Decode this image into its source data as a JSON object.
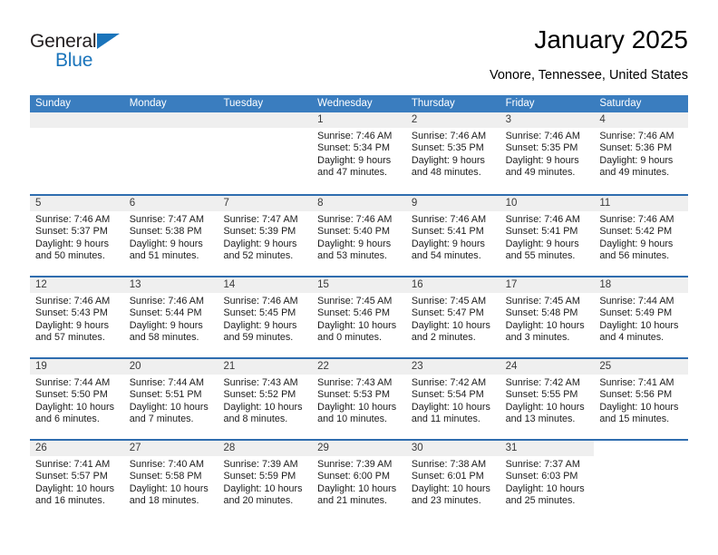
{
  "brand": {
    "name_part1": "General",
    "name_part2": "Blue",
    "accent_color": "#1a74bb"
  },
  "header": {
    "title": "January 2025",
    "location": "Vonore, Tennessee, United States"
  },
  "theme": {
    "header_blue": "#3a7dbf",
    "divider_blue": "#2f6daf",
    "daynum_band": "#efefef"
  },
  "weekdays": [
    "Sunday",
    "Monday",
    "Tuesday",
    "Wednesday",
    "Thursday",
    "Friday",
    "Saturday"
  ],
  "labels": {
    "sunrise": "Sunrise:",
    "sunset": "Sunset:",
    "daylight": "Daylight:"
  },
  "weeks": [
    [
      {
        "empty": true
      },
      {
        "empty": true
      },
      {
        "empty": true
      },
      {
        "day": "1",
        "sunrise": "Sunrise: 7:46 AM",
        "sunset": "Sunset: 5:34 PM",
        "daylight1": "Daylight: 9 hours",
        "daylight2": "and 47 minutes."
      },
      {
        "day": "2",
        "sunrise": "Sunrise: 7:46 AM",
        "sunset": "Sunset: 5:35 PM",
        "daylight1": "Daylight: 9 hours",
        "daylight2": "and 48 minutes."
      },
      {
        "day": "3",
        "sunrise": "Sunrise: 7:46 AM",
        "sunset": "Sunset: 5:35 PM",
        "daylight1": "Daylight: 9 hours",
        "daylight2": "and 49 minutes."
      },
      {
        "day": "4",
        "sunrise": "Sunrise: 7:46 AM",
        "sunset": "Sunset: 5:36 PM",
        "daylight1": "Daylight: 9 hours",
        "daylight2": "and 49 minutes."
      }
    ],
    [
      {
        "day": "5",
        "sunrise": "Sunrise: 7:46 AM",
        "sunset": "Sunset: 5:37 PM",
        "daylight1": "Daylight: 9 hours",
        "daylight2": "and 50 minutes."
      },
      {
        "day": "6",
        "sunrise": "Sunrise: 7:47 AM",
        "sunset": "Sunset: 5:38 PM",
        "daylight1": "Daylight: 9 hours",
        "daylight2": "and 51 minutes."
      },
      {
        "day": "7",
        "sunrise": "Sunrise: 7:47 AM",
        "sunset": "Sunset: 5:39 PM",
        "daylight1": "Daylight: 9 hours",
        "daylight2": "and 52 minutes."
      },
      {
        "day": "8",
        "sunrise": "Sunrise: 7:46 AM",
        "sunset": "Sunset: 5:40 PM",
        "daylight1": "Daylight: 9 hours",
        "daylight2": "and 53 minutes."
      },
      {
        "day": "9",
        "sunrise": "Sunrise: 7:46 AM",
        "sunset": "Sunset: 5:41 PM",
        "daylight1": "Daylight: 9 hours",
        "daylight2": "and 54 minutes."
      },
      {
        "day": "10",
        "sunrise": "Sunrise: 7:46 AM",
        "sunset": "Sunset: 5:41 PM",
        "daylight1": "Daylight: 9 hours",
        "daylight2": "and 55 minutes."
      },
      {
        "day": "11",
        "sunrise": "Sunrise: 7:46 AM",
        "sunset": "Sunset: 5:42 PM",
        "daylight1": "Daylight: 9 hours",
        "daylight2": "and 56 minutes."
      }
    ],
    [
      {
        "day": "12",
        "sunrise": "Sunrise: 7:46 AM",
        "sunset": "Sunset: 5:43 PM",
        "daylight1": "Daylight: 9 hours",
        "daylight2": "and 57 minutes."
      },
      {
        "day": "13",
        "sunrise": "Sunrise: 7:46 AM",
        "sunset": "Sunset: 5:44 PM",
        "daylight1": "Daylight: 9 hours",
        "daylight2": "and 58 minutes."
      },
      {
        "day": "14",
        "sunrise": "Sunrise: 7:46 AM",
        "sunset": "Sunset: 5:45 PM",
        "daylight1": "Daylight: 9 hours",
        "daylight2": "and 59 minutes."
      },
      {
        "day": "15",
        "sunrise": "Sunrise: 7:45 AM",
        "sunset": "Sunset: 5:46 PM",
        "daylight1": "Daylight: 10 hours",
        "daylight2": "and 0 minutes."
      },
      {
        "day": "16",
        "sunrise": "Sunrise: 7:45 AM",
        "sunset": "Sunset: 5:47 PM",
        "daylight1": "Daylight: 10 hours",
        "daylight2": "and 2 minutes."
      },
      {
        "day": "17",
        "sunrise": "Sunrise: 7:45 AM",
        "sunset": "Sunset: 5:48 PM",
        "daylight1": "Daylight: 10 hours",
        "daylight2": "and 3 minutes."
      },
      {
        "day": "18",
        "sunrise": "Sunrise: 7:44 AM",
        "sunset": "Sunset: 5:49 PM",
        "daylight1": "Daylight: 10 hours",
        "daylight2": "and 4 minutes."
      }
    ],
    [
      {
        "day": "19",
        "sunrise": "Sunrise: 7:44 AM",
        "sunset": "Sunset: 5:50 PM",
        "daylight1": "Daylight: 10 hours",
        "daylight2": "and 6 minutes."
      },
      {
        "day": "20",
        "sunrise": "Sunrise: 7:44 AM",
        "sunset": "Sunset: 5:51 PM",
        "daylight1": "Daylight: 10 hours",
        "daylight2": "and 7 minutes."
      },
      {
        "day": "21",
        "sunrise": "Sunrise: 7:43 AM",
        "sunset": "Sunset: 5:52 PM",
        "daylight1": "Daylight: 10 hours",
        "daylight2": "and 8 minutes."
      },
      {
        "day": "22",
        "sunrise": "Sunrise: 7:43 AM",
        "sunset": "Sunset: 5:53 PM",
        "daylight1": "Daylight: 10 hours",
        "daylight2": "and 10 minutes."
      },
      {
        "day": "23",
        "sunrise": "Sunrise: 7:42 AM",
        "sunset": "Sunset: 5:54 PM",
        "daylight1": "Daylight: 10 hours",
        "daylight2": "and 11 minutes."
      },
      {
        "day": "24",
        "sunrise": "Sunrise: 7:42 AM",
        "sunset": "Sunset: 5:55 PM",
        "daylight1": "Daylight: 10 hours",
        "daylight2": "and 13 minutes."
      },
      {
        "day": "25",
        "sunrise": "Sunrise: 7:41 AM",
        "sunset": "Sunset: 5:56 PM",
        "daylight1": "Daylight: 10 hours",
        "daylight2": "and 15 minutes."
      }
    ],
    [
      {
        "day": "26",
        "sunrise": "Sunrise: 7:41 AM",
        "sunset": "Sunset: 5:57 PM",
        "daylight1": "Daylight: 10 hours",
        "daylight2": "and 16 minutes."
      },
      {
        "day": "27",
        "sunrise": "Sunrise: 7:40 AM",
        "sunset": "Sunset: 5:58 PM",
        "daylight1": "Daylight: 10 hours",
        "daylight2": "and 18 minutes."
      },
      {
        "day": "28",
        "sunrise": "Sunrise: 7:39 AM",
        "sunset": "Sunset: 5:59 PM",
        "daylight1": "Daylight: 10 hours",
        "daylight2": "and 20 minutes."
      },
      {
        "day": "29",
        "sunrise": "Sunrise: 7:39 AM",
        "sunset": "Sunset: 6:00 PM",
        "daylight1": "Daylight: 10 hours",
        "daylight2": "and 21 minutes."
      },
      {
        "day": "30",
        "sunrise": "Sunrise: 7:38 AM",
        "sunset": "Sunset: 6:01 PM",
        "daylight1": "Daylight: 10 hours",
        "daylight2": "and 23 minutes."
      },
      {
        "day": "31",
        "sunrise": "Sunrise: 7:37 AM",
        "sunset": "Sunset: 6:03 PM",
        "daylight1": "Daylight: 10 hours",
        "daylight2": "and 25 minutes."
      },
      {
        "empty": true,
        "noband": true
      }
    ]
  ]
}
